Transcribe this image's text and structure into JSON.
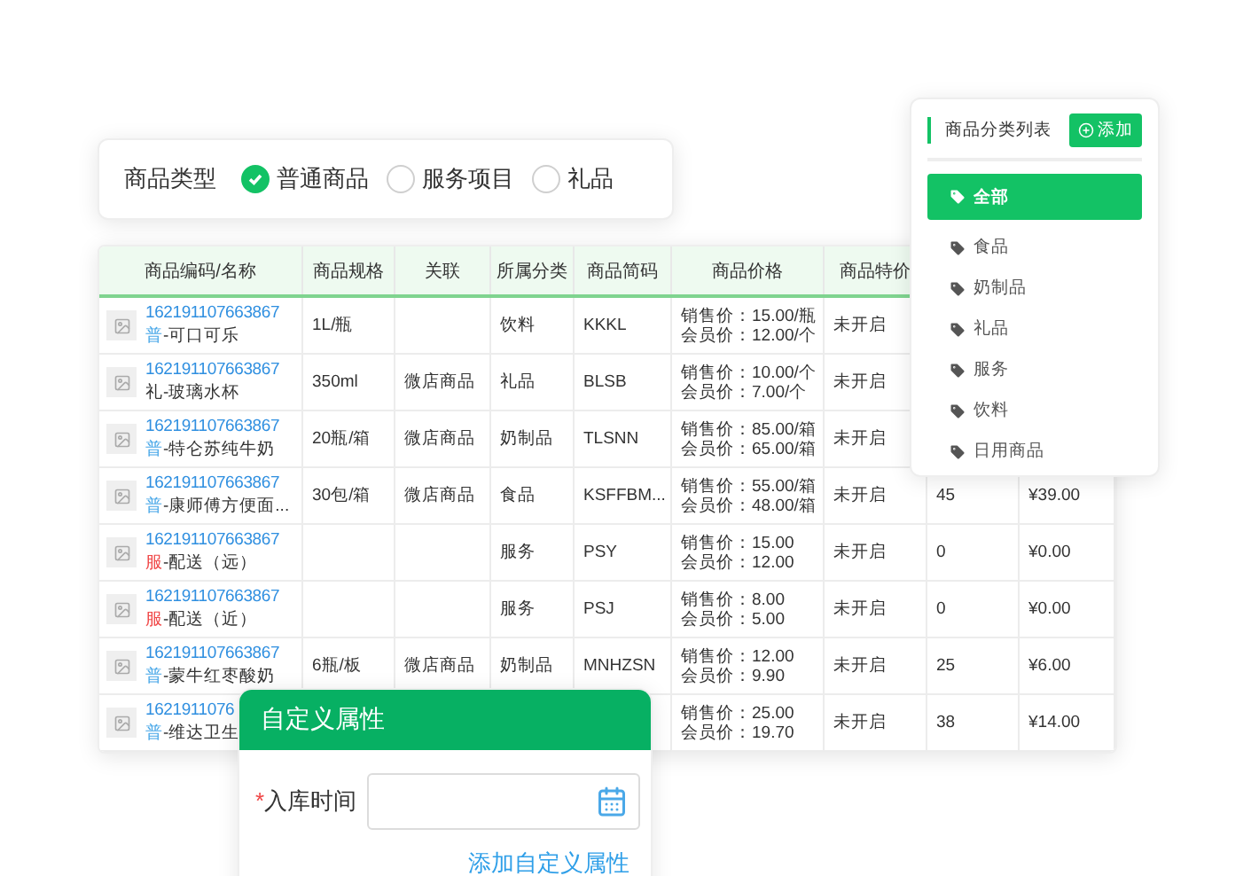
{
  "type_selector": {
    "label": "商品类型",
    "options": [
      {
        "label": "普通商品",
        "selected": true
      },
      {
        "label": "服务项目",
        "selected": false
      },
      {
        "label": "礼品",
        "selected": false
      }
    ]
  },
  "table": {
    "columns": [
      "商品编码/名称",
      "商品规格",
      "关联",
      "所属分类",
      "商品简码",
      "商品价格",
      "商品特价"
    ],
    "rows": [
      {
        "code": "162191107663867",
        "prefix": {
          "text": "普",
          "color": "#4aa8e8"
        },
        "name": "-可口可乐",
        "spec": "1L/瓶",
        "category": "饮料",
        "short_code": "KKKL",
        "sale_price": "销售价：15.00/瓶",
        "member_price": "会员价：12.00/个",
        "special": "未开启"
      },
      {
        "code": "162191107663867",
        "prefix": {
          "text": "礼",
          "color": "#333333"
        },
        "name": "-玻璃水杯",
        "spec": "350ml",
        "link": "微店商品",
        "category": "礼品",
        "short_code": "BLSB",
        "sale_price": "销售价：10.00/个",
        "member_price": "会员价：7.00/个",
        "special": "未开启"
      },
      {
        "code": "162191107663867",
        "prefix": {
          "text": "普",
          "color": "#4aa8e8"
        },
        "name": "-特仑苏纯牛奶",
        "spec": "20瓶/箱",
        "link": "微店商品",
        "category": "奶制品",
        "short_code": "TLSNN",
        "sale_price": "销售价：85.00/箱",
        "member_price": "会员价：65.00/箱",
        "special": "未开启"
      },
      {
        "code": "162191107663867",
        "prefix": {
          "text": "普",
          "color": "#4aa8e8"
        },
        "name": "-康师傅方便面...",
        "spec": "30包/箱",
        "link": "微店商品",
        "category": "食品",
        "short_code": "KSFFBM...",
        "sale_price": "销售价：55.00/箱",
        "member_price": "会员价：48.00/箱",
        "special": "未开启",
        "stock": "45",
        "amount": "¥39.00"
      },
      {
        "code": "162191107663867",
        "prefix": {
          "text": "服",
          "color": "#f04848"
        },
        "name": "-配送（远）",
        "category": "服务",
        "short_code": "PSY",
        "sale_price": "销售价：15.00",
        "member_price": "会员价：12.00",
        "special": "未开启",
        "stock": "0",
        "amount": "¥0.00"
      },
      {
        "code": "162191107663867",
        "prefix": {
          "text": "服",
          "color": "#f04848"
        },
        "name": "-配送（近）",
        "category": "服务",
        "short_code": "PSJ",
        "sale_price": "销售价：8.00",
        "member_price": "会员价：5.00",
        "special": "未开启",
        "stock": "0",
        "amount": "¥0.00"
      },
      {
        "code": "162191107663867",
        "prefix": {
          "text": "普",
          "color": "#4aa8e8"
        },
        "name": "-蒙牛红枣酸奶",
        "spec": "6瓶/板",
        "link": "微店商品",
        "category": "奶制品",
        "short_code": "MNHZSN",
        "sale_price": "销售价：12.00",
        "member_price": "会员价：9.90",
        "special": "未开启",
        "stock": "25",
        "amount": "¥6.00"
      },
      {
        "code": "1621911076",
        "prefix": {
          "text": "普",
          "color": "#4aa8e8"
        },
        "name": "-维达卫生",
        "sale_price": "销售价：25.00",
        "member_price": "会员价：19.70",
        "special": "未开启",
        "stock": "38",
        "amount": "¥14.00"
      }
    ]
  },
  "category_panel": {
    "title": "商品分类列表",
    "add_button": "添加",
    "items": [
      {
        "label": "全部",
        "selected": true
      },
      {
        "label": "食品",
        "selected": false
      },
      {
        "label": "奶制品",
        "selected": false
      },
      {
        "label": "礼品",
        "selected": false
      },
      {
        "label": "服务",
        "selected": false
      },
      {
        "label": "饮料",
        "selected": false
      },
      {
        "label": "日用商品",
        "selected": false
      }
    ]
  },
  "dialog": {
    "title": "自定义属性",
    "fields": [
      {
        "required_mark": "*",
        "label": "入库时间"
      }
    ],
    "link": "添加自定义属性"
  }
}
